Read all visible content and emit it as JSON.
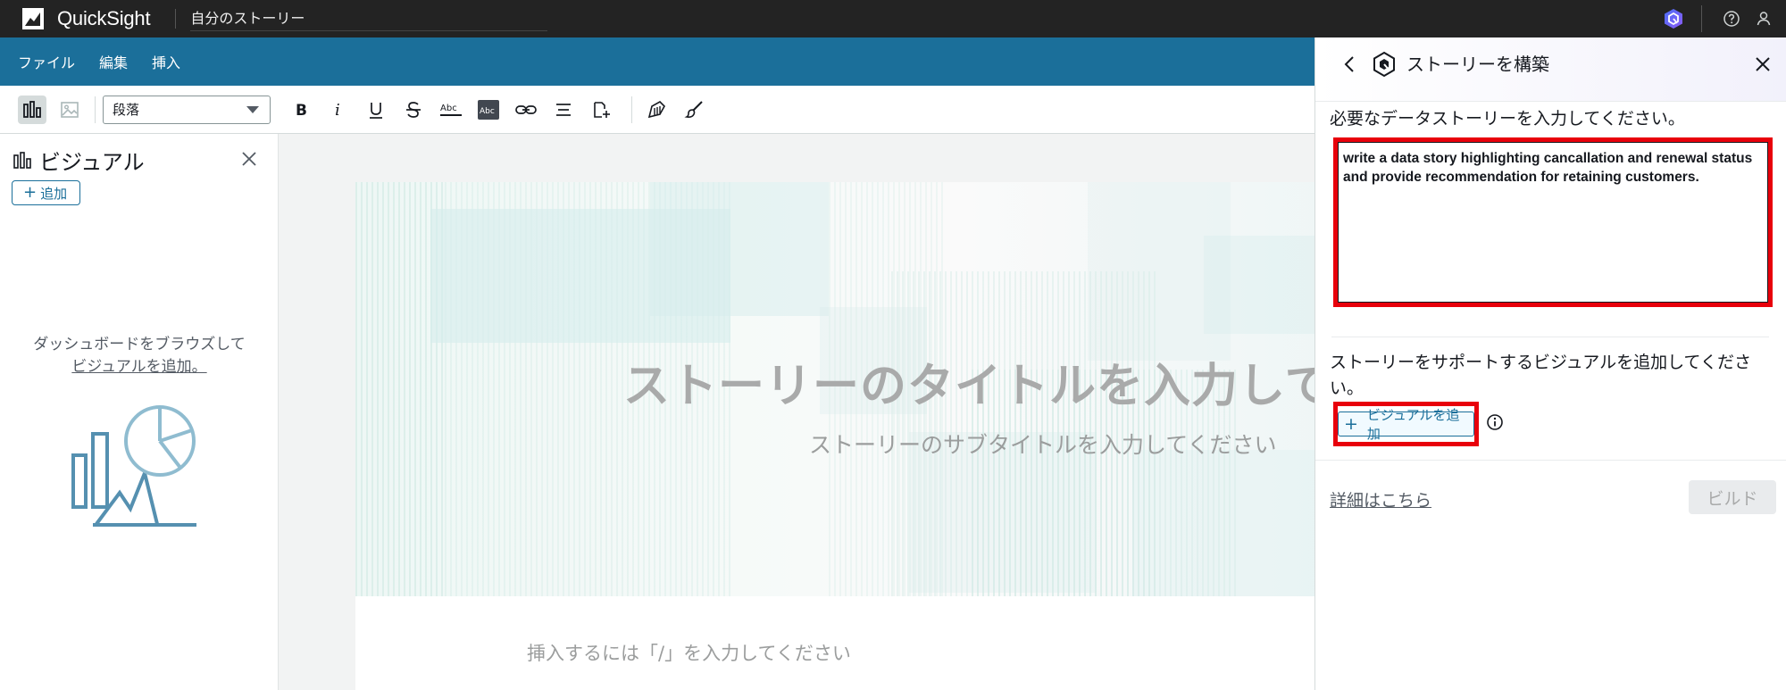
{
  "topbar": {
    "app_name": "QuickSight",
    "document_title": "自分のストーリー",
    "icons": [
      "quicksight-logo-icon",
      "q-assistant-icon",
      "help-icon",
      "user-icon"
    ]
  },
  "menubar": {
    "items": [
      {
        "label": "ファイル"
      },
      {
        "label": "編集"
      },
      {
        "label": "挿入"
      }
    ]
  },
  "toolbar": {
    "paragraph_style": "段落",
    "icons": [
      "visuals-icon",
      "image-icon",
      "bold-icon",
      "italic-icon",
      "underline-icon",
      "strikethrough-icon",
      "text-color-icon",
      "highlight-icon",
      "link-icon",
      "align-icon",
      "insert-block-icon",
      "theme-icon",
      "paint-brush-icon"
    ]
  },
  "left_panel": {
    "title": "ビジュアル",
    "add_label": "追加",
    "empty_line1": "ダッシュボードをブラウズして",
    "empty_link": "ビジュアルを追加。"
  },
  "canvas": {
    "title_placeholder": "ストーリーのタイトルを入力してく",
    "subtitle_placeholder": "ストーリーのサブタイトルを入力してください",
    "insert_hint": "挿入するには「/」を入力してください"
  },
  "right_panel": {
    "title": "ストーリーを構築",
    "prompt_label": "必要なデータストーリーを入力してください。",
    "prompt_value": "write a data story highlighting cancallation and renewal status and provide recommendation for retaining customers.",
    "visual_label": "ストーリーをサポートするビジュアルを追加してください。",
    "add_visual_label": "ビジュアルを追加",
    "learn_more": "詳細はこちら",
    "build_button": "ビルド",
    "highlight_color": "#e8000b"
  },
  "colors": {
    "topbar_bg": "#232323",
    "menubar_bg": "#1b6f9a",
    "accent": "#1b6f9a"
  }
}
